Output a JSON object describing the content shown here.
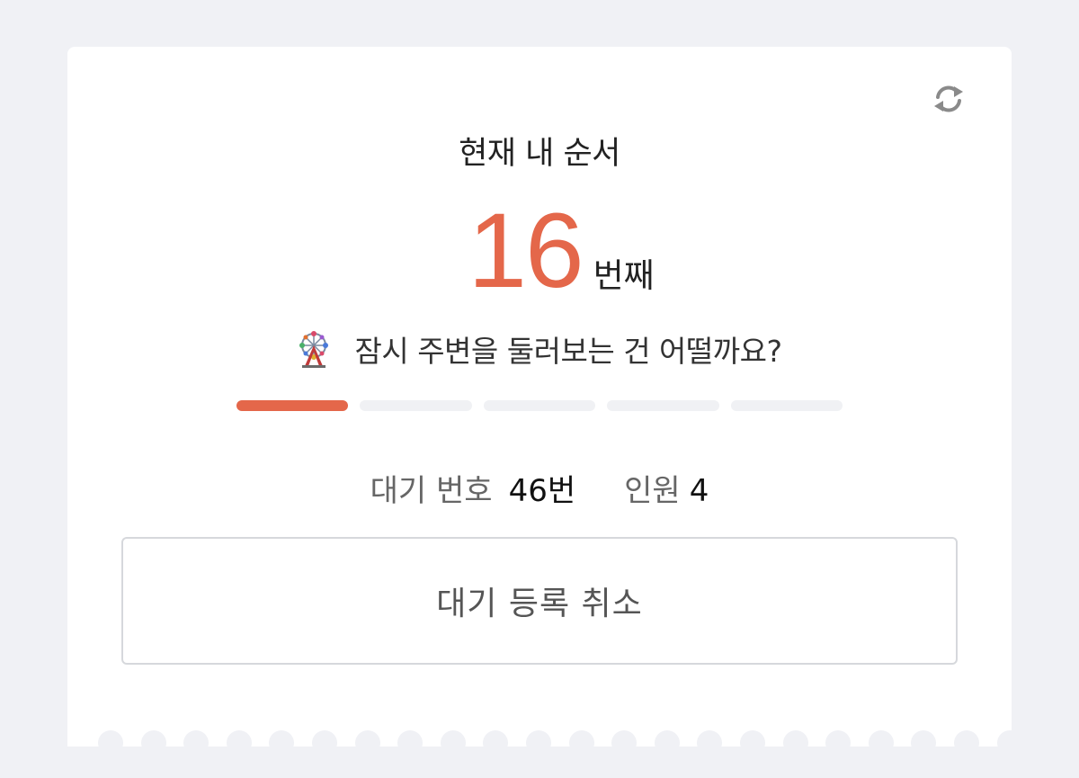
{
  "header": {
    "title": "현재 내 순서",
    "refresh_icon": "refresh-icon"
  },
  "rank": {
    "number": "16",
    "unit": "번째"
  },
  "message": {
    "icon": "ferris-wheel-icon",
    "text": "잠시 주변을 둘러보는 건 어떨까요?"
  },
  "progress": {
    "segments_total": 5,
    "segments_filled": 1,
    "active_color": "#e4674a",
    "inactive_color": "#f0f1f4"
  },
  "info": {
    "wait_number_label": "대기 번호",
    "wait_number_value": "46번",
    "party_label": "인원",
    "party_value": "4"
  },
  "actions": {
    "cancel_label": "대기 등록 취소"
  },
  "colors": {
    "accent": "#e4674a",
    "background": "#f0f1f5",
    "card": "#ffffff"
  }
}
